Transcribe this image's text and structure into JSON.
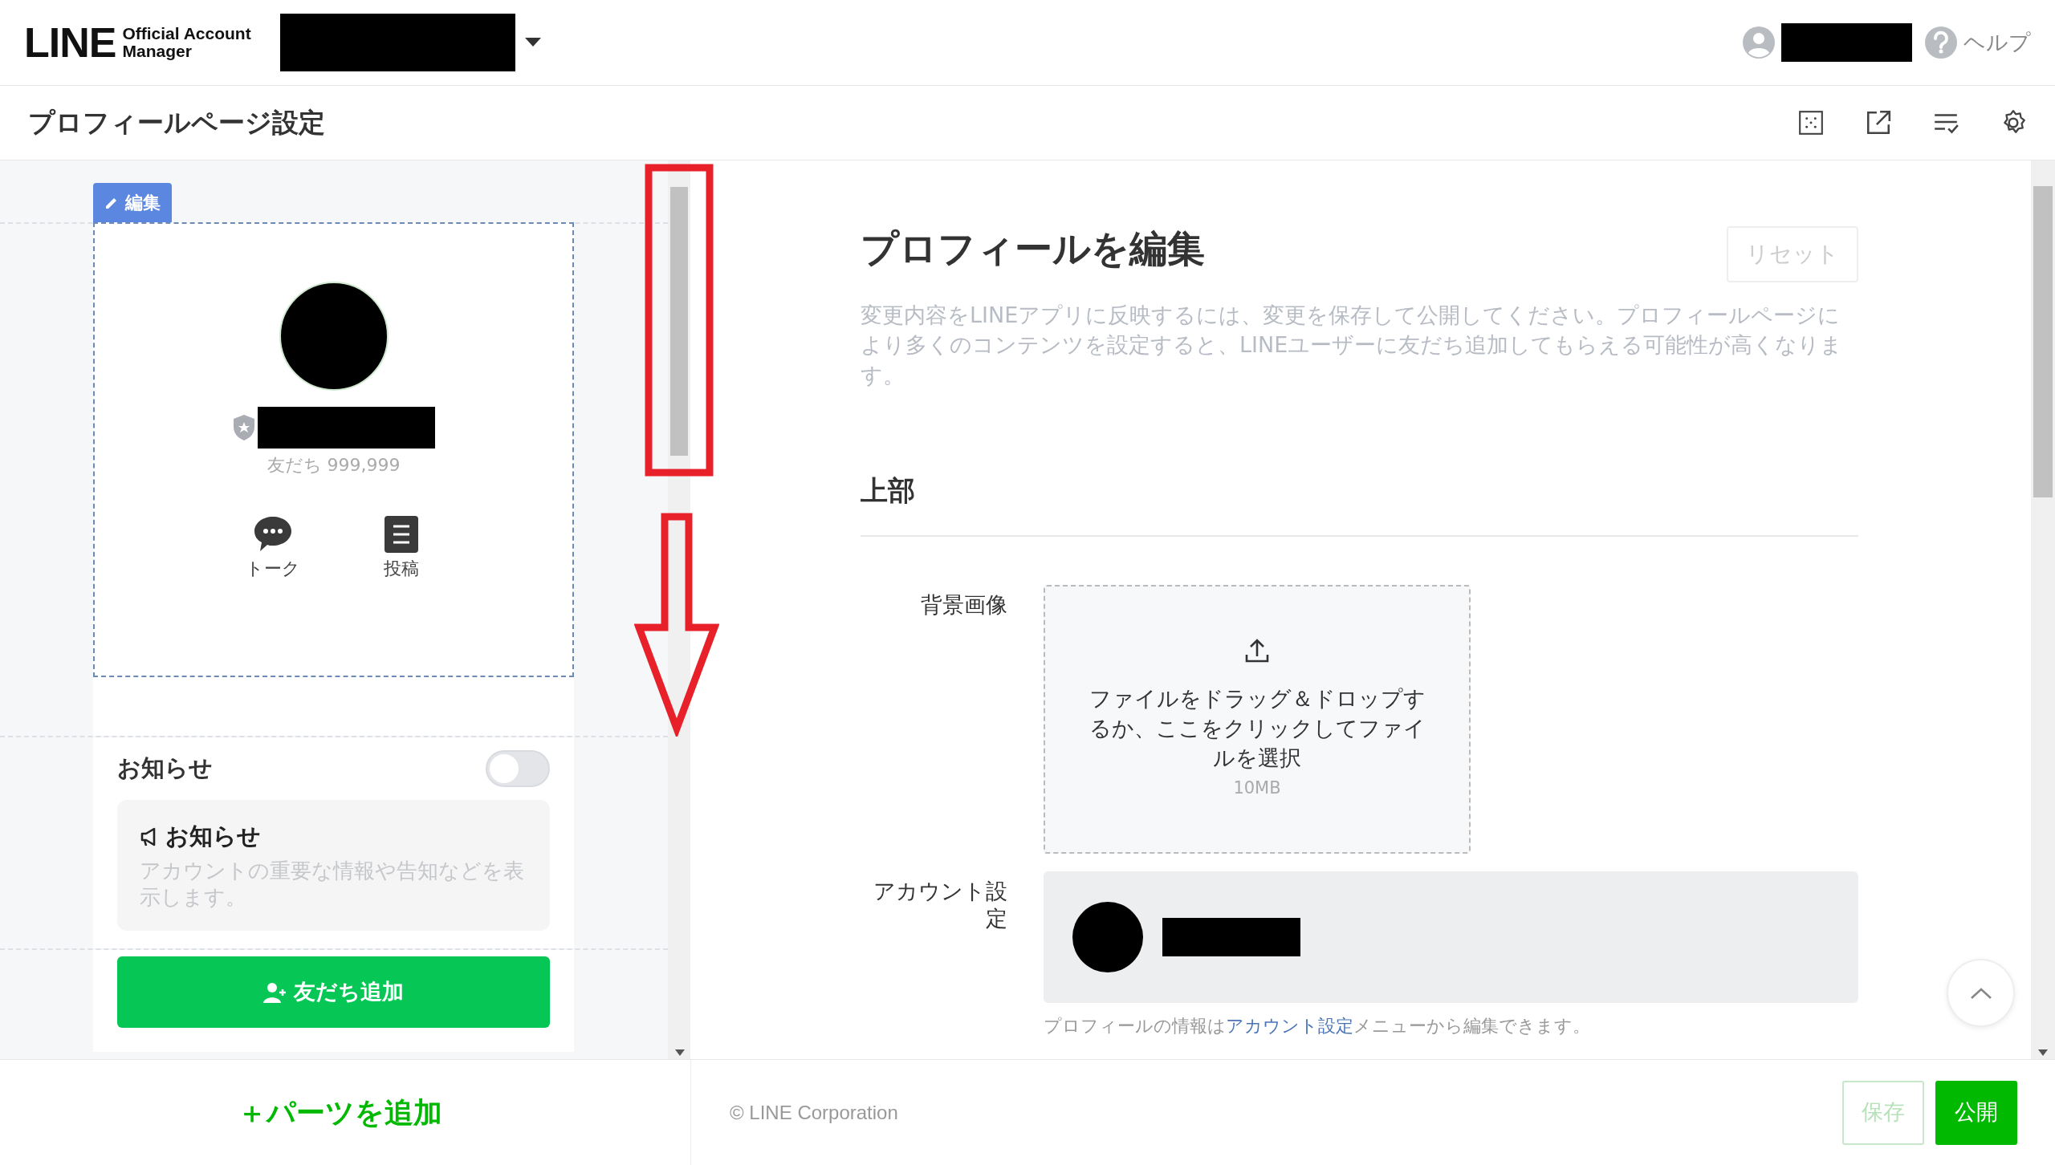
{
  "header": {
    "logo": {
      "wordmark": "LINE",
      "subtitle_1": "Official Account",
      "subtitle_2": "Manager"
    },
    "help": "ヘルプ"
  },
  "toolbar": {
    "title": "プロフィールページ設定"
  },
  "preview": {
    "edit_badge": "編集",
    "friends": "友だち 999,999",
    "actions": [
      {
        "label": "トーク",
        "kind": "chat"
      },
      {
        "label": "投稿",
        "kind": "post"
      }
    ],
    "notice": {
      "title": "お知らせ",
      "on": false,
      "card_title": "お知らせ",
      "card_text": "アカウントの重要な情報や告知などを表示します。"
    },
    "add_friend": "友だち追加",
    "add_parts": "＋パーツを追加"
  },
  "editor": {
    "title": "プロフィールを編集",
    "reset": "リセット",
    "description": "変更内容をLINEアプリに反映するには、変更を保存して公開してください。プロフィールページにより多くのコンテンツを設定すると、LINEユーザーに友だち追加してもらえる可能性が高くなります。",
    "section": "上部",
    "fields": [
      {
        "label": "背景画像",
        "kind": "upload",
        "text": "ファイルをドラッグ＆ドロップするか、ここをクリックしてファイルを選択",
        "hint": "10MB"
      },
      {
        "label": "アカウント設定",
        "kind": "account",
        "note_before": "プロフィールの情報は",
        "note_link": "アカウント設定",
        "note_after": "メニューから編集できます。"
      }
    ]
  },
  "footer": {
    "copyright": "© LINE Corporation",
    "buttons": [
      {
        "label": "保存",
        "disabled": true
      },
      {
        "label": "公開",
        "disabled": false
      }
    ]
  }
}
